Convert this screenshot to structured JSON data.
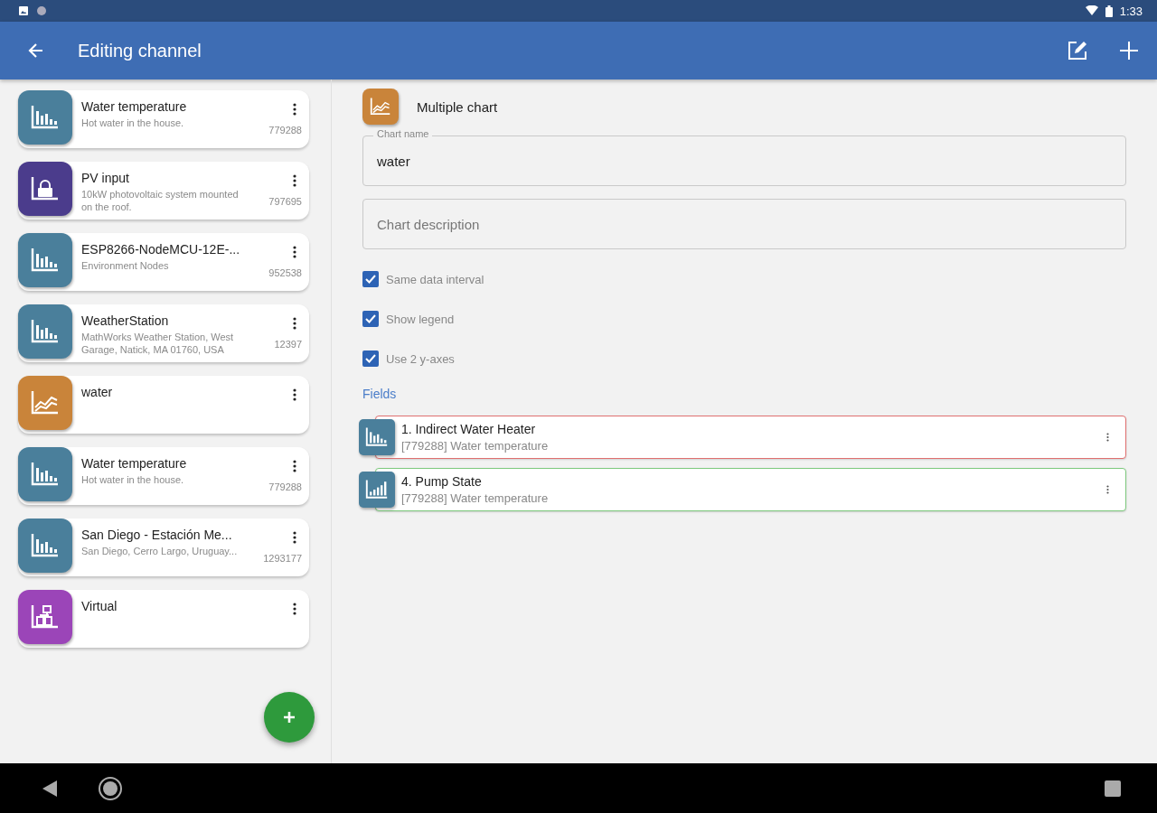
{
  "status_bar": {
    "time": "1:33"
  },
  "app_bar": {
    "title": "Editing channel"
  },
  "channels": [
    {
      "name": "Water temperature",
      "description": "Hot water in the house.",
      "id": "779288",
      "kind": "bars",
      "color": "#4a7f9b"
    },
    {
      "name": "PV input",
      "description": "10kW photovoltaic system mounted on the roof.",
      "id": "797695",
      "kind": "lock",
      "color": "#4b3c8c"
    },
    {
      "name": "ESP8266-NodeMCU-12E-...",
      "description": "Environment Nodes",
      "id": "952538",
      "kind": "bars",
      "color": "#4a7f9b"
    },
    {
      "name": "WeatherStation",
      "description": "MathWorks Weather Station, West Garage, Natick, MA 01760, USA",
      "id": "12397",
      "kind": "bars",
      "color": "#4a7f9b"
    },
    {
      "name": "water",
      "kind": "lines",
      "color": "#c9843a"
    },
    {
      "name": "Water temperature",
      "description": "Hot water in the house.",
      "id": "779288",
      "kind": "bars",
      "color": "#4a7f9b"
    },
    {
      "name": "San Diego - Estación Me...",
      "description": "San Diego, Cerro Largo, Uruguay...",
      "id": "1293177",
      "kind": "bars",
      "color": "#4a7f9b"
    },
    {
      "name": "Virtual",
      "kind": "virtual",
      "color": "#9b45b8"
    }
  ],
  "chart": {
    "type_label": "Multiple chart",
    "name_label": "Chart name",
    "name_value": "water",
    "description_placeholder": "Chart description"
  },
  "options": [
    {
      "label": "Same data interval",
      "checked": true
    },
    {
      "label": "Show legend",
      "checked": true
    },
    {
      "label": "Use 2 y-axes",
      "checked": true
    }
  ],
  "fields_heading": "Fields",
  "fields": [
    {
      "title": "1. Indirect Water Heater",
      "source": "[779288] Water temperature",
      "kind": "bars",
      "color": "#e07070"
    },
    {
      "title": "4. Pump State",
      "source": "[779288] Water temperature",
      "kind": "rising",
      "color": "#7dc97d"
    }
  ]
}
